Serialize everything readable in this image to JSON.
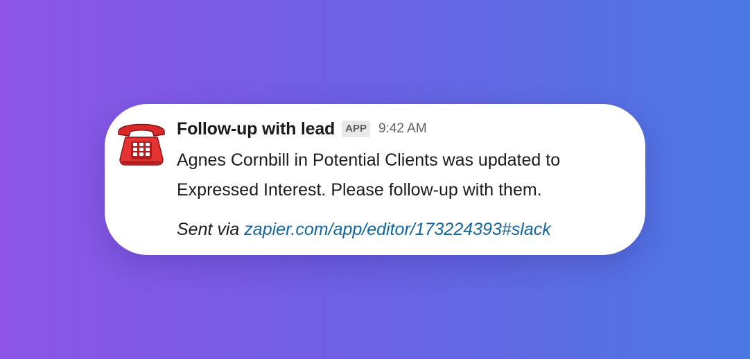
{
  "message": {
    "avatar_icon": "red-telephone-icon",
    "sender": "Follow-up with lead",
    "badge": "APP",
    "time": "9:42 AM",
    "body_line_1": "Agnes Cornbill in Potential Clients was updated to",
    "body_line_2": "Expressed Interest. Please follow-up with them.",
    "footer_prefix": "Sent via",
    "footer_link": "zapier.com/app/editor/173224393#slack"
  },
  "colors": {
    "link": "#1264a3",
    "text": "#1d1c1d",
    "muted": "#616061",
    "phone_red": "#d82a2a"
  }
}
